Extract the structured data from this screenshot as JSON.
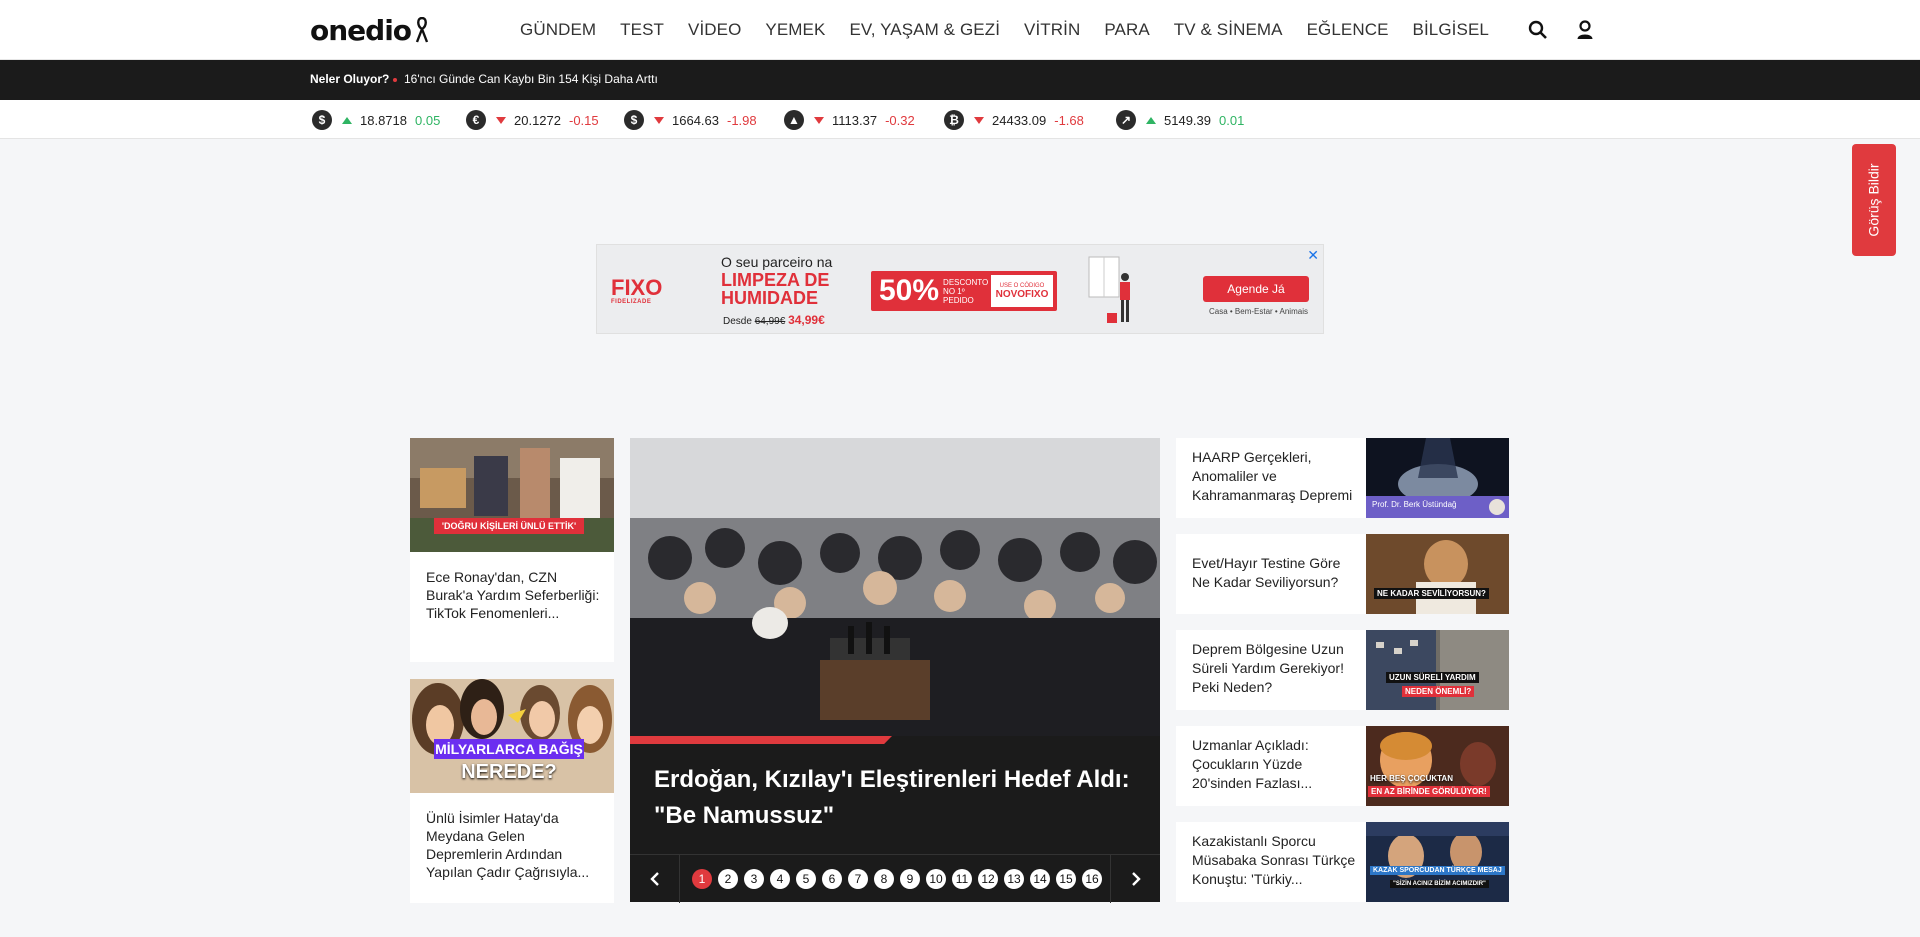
{
  "header": {
    "logo": "onedio",
    "nav": [
      "GÜNDEM",
      "TEST",
      "VİDEO",
      "YEMEK",
      "EV, YAŞAM & GEZİ",
      "VİTRİN",
      "PARA",
      "TV & SİNEMA",
      "EĞLENCE",
      "BİLGİSEL"
    ],
    "icons": [
      "search-icon",
      "user-icon"
    ]
  },
  "ticker": {
    "label": "Neler Oluyor?",
    "headline": "16'ncı Günde Can Kaybı Bin 154 Kişi Daha Arttı"
  },
  "markets": [
    {
      "icon": "$",
      "dir": "up",
      "value": "18.8718",
      "change": "0.05"
    },
    {
      "icon": "€",
      "dir": "down",
      "value": "20.1272",
      "change": "-0.15"
    },
    {
      "icon": "$",
      "dir": "down",
      "value": "1664.63",
      "change": "-1.98"
    },
    {
      "icon": "▲",
      "dir": "down",
      "value": "1113.37",
      "change": "-0.32"
    },
    {
      "icon": "₿",
      "dir": "down",
      "value": "24433.09",
      "change": "-1.68"
    },
    {
      "icon": "↗",
      "dir": "up",
      "value": "5149.39",
      "change": "0.01"
    }
  ],
  "feedback": "Görüş Bildir",
  "ad": {
    "close": "✕",
    "brand": "FIXO",
    "brand_sub": "FIDELIZADE",
    "line1": "O seu parceiro na",
    "line2": "LIMPEZA DE",
    "line3": "HUMIDADE",
    "price_prefix": "Desde",
    "price_old": "64,99€",
    "price": "34,99€",
    "promo_pct": "50%",
    "promo_desc": "DESCONTO NO 1º PEDIDO",
    "promo_code_label": "USE O CÓDIGO",
    "promo_code": "NOVOFIXO",
    "cta": "Agende Já",
    "cta_sub": "Casa • Bem-Estar • Animais"
  },
  "left_cards": [
    {
      "badge": "'DOĞRU KİŞİLERİ ÜNLÜ ETTİK'",
      "caption": "Ece Ronay'dan, CZN Burak'a Yardım Seferberliği: TikTok Fenomenleri..."
    },
    {
      "badge_top": "MİLYARLARCA BAĞIŞ",
      "badge_bottom": "NEREDE?",
      "caption": "Ünlü İsimler Hatay'da Meydana Gelen Depremlerin Ardından Yapılan Çadır Çağrısıyla..."
    }
  ],
  "hero": {
    "title": "Erdoğan, Kızılay'ı Eleştirenleri Hedef Aldı: \"Be Namussuz\"",
    "pages": [
      "1",
      "2",
      "3",
      "4",
      "5",
      "6",
      "7",
      "8",
      "9",
      "10",
      "11",
      "12",
      "13",
      "14",
      "15",
      "16"
    ],
    "active_page": "1"
  },
  "right_cards": [
    {
      "caption": "HAARP Gerçekleri, Anomaliler ve Kahramanmaraş Depremi",
      "badge": "Prof. Dr. Berk Üstündağ"
    },
    {
      "caption": "Evet/Hayır Testine Göre Ne Kadar Seviliyorsun?",
      "badge": "NE KADAR SEVİLİYORSUN?"
    },
    {
      "caption": "Deprem Bölgesine Uzun Süreli Yardım Gerekiyor! Peki Neden?",
      "badge": "UZUN SÜRELİ YARDIM",
      "badge2": "NEDEN ÖNEMLİ?"
    },
    {
      "caption": "Uzmanlar Açıkladı: Çocukların Yüzde 20'sinden Fazlası...",
      "badge": "HER BEŞ ÇOCUKTAN",
      "badge2": "EN AZ BİRİNDE GÖRÜLÜYOR!"
    },
    {
      "caption": "Kazakistanlı Sporcu Müsabaka Sonrası Türkçe Konuştu: 'Türkiy...",
      "badge": "KAZAK SPORCUDAN TÜRKÇE MESAJ",
      "badge2": "\"SİZİN ACINIZ BİZİM ACIMIZDIR\""
    }
  ],
  "colors": {
    "accent": "#e03a3e",
    "dark": "#1b1b1b",
    "up": "#2fb463",
    "down": "#e03a3e"
  }
}
